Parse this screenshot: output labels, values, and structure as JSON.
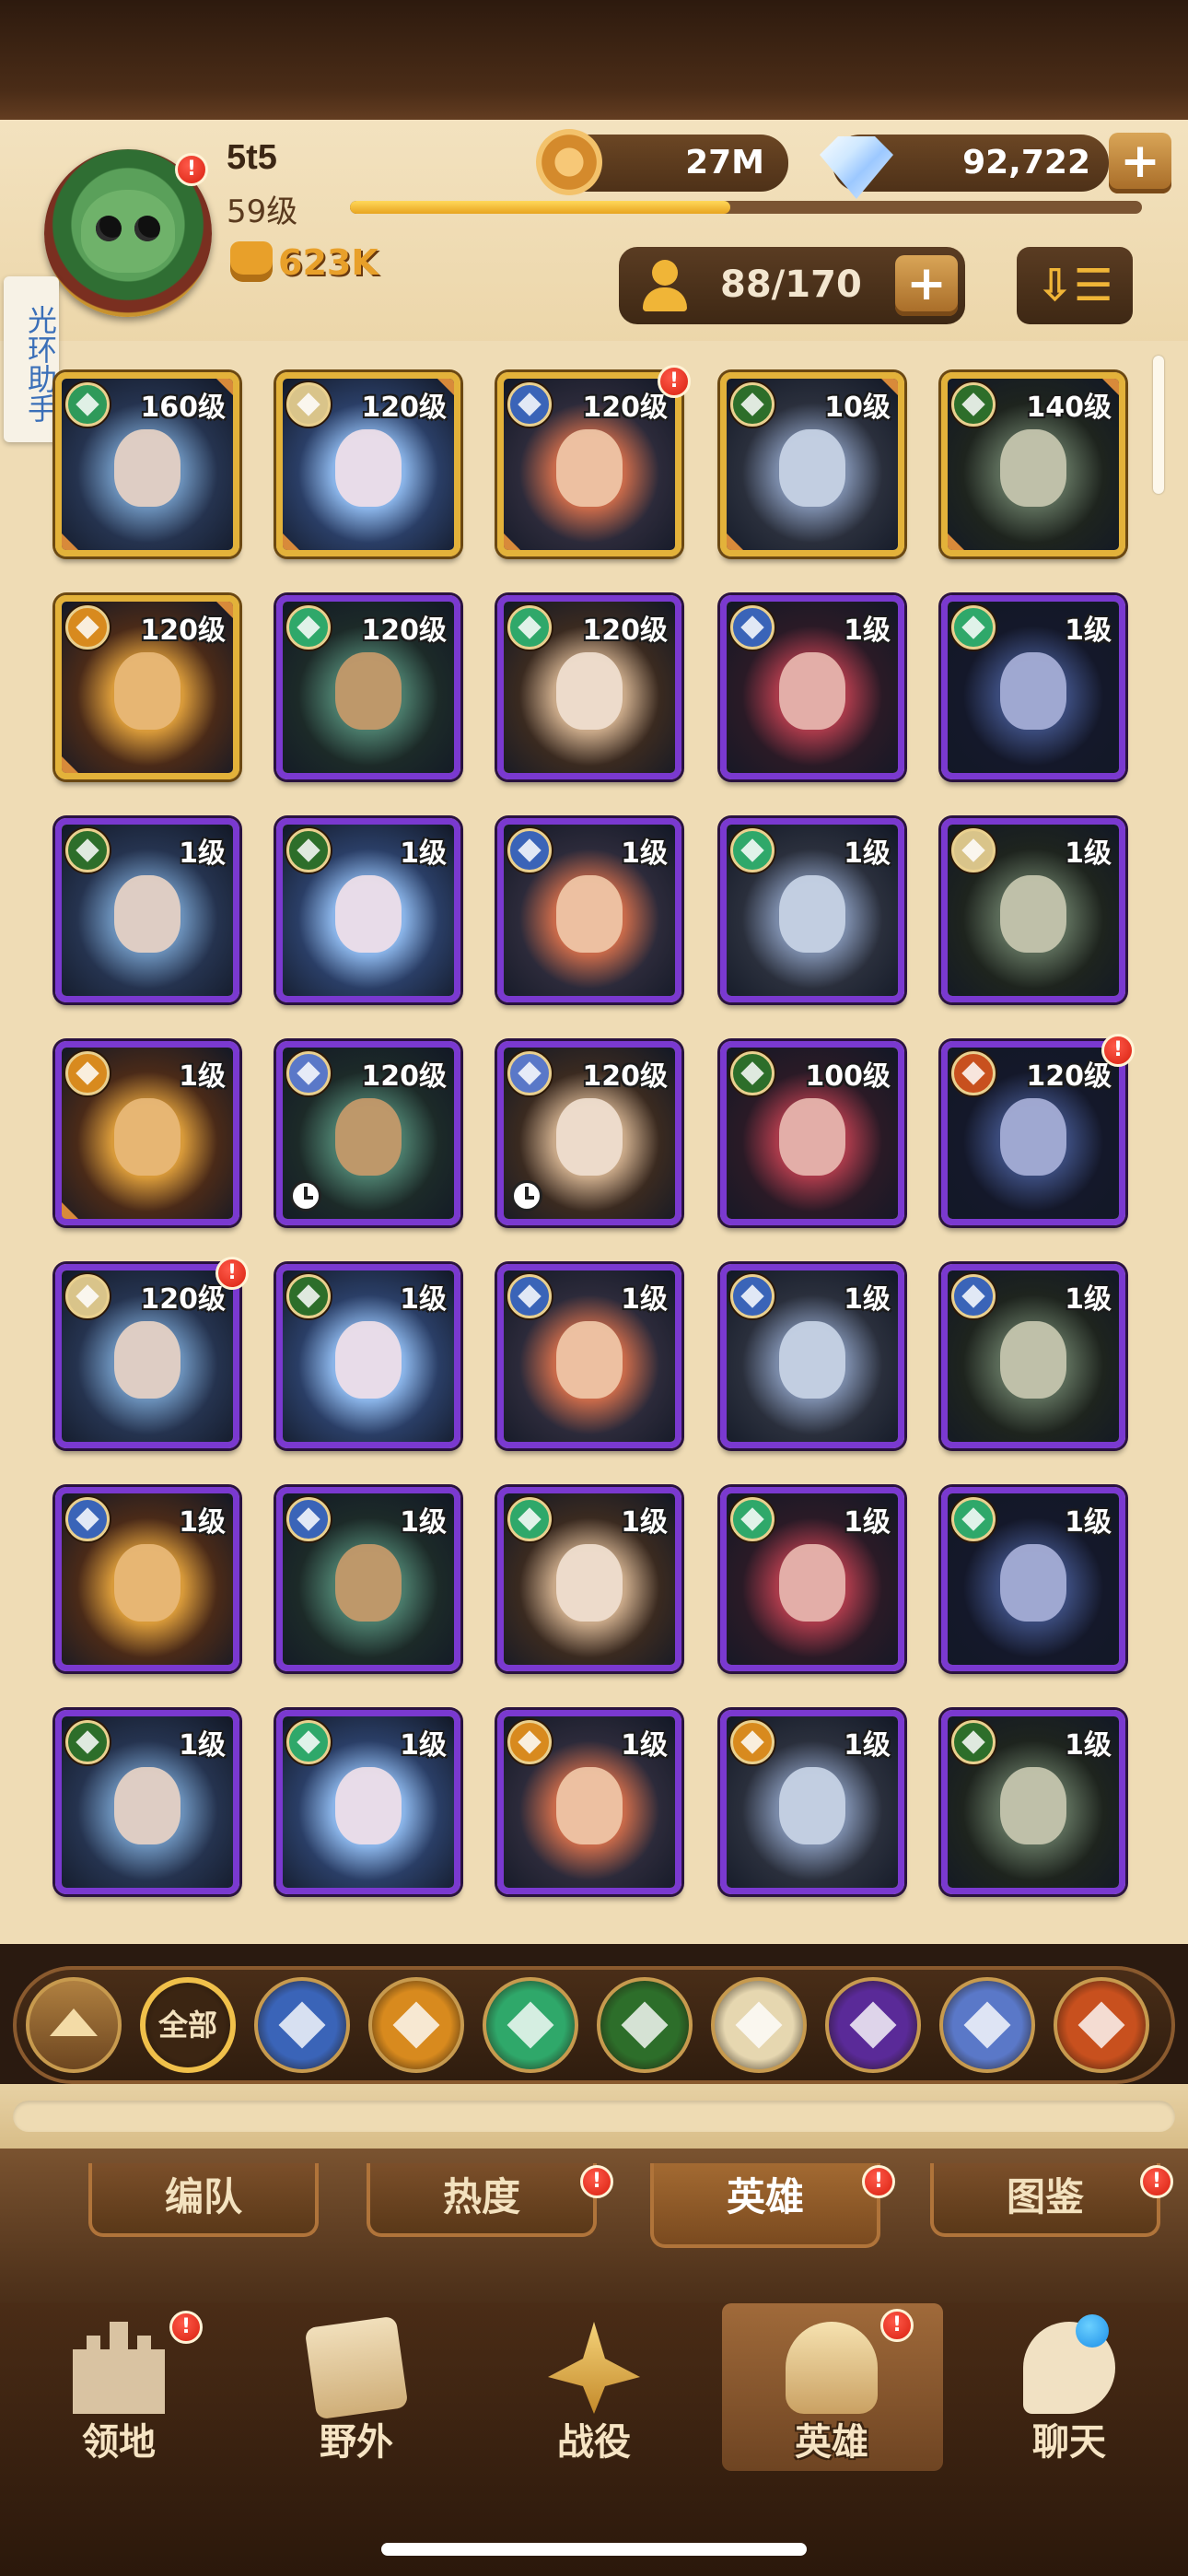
{
  "player": {
    "name": "5t5",
    "level": "59级",
    "xp_progress": 0.48,
    "power": "623K"
  },
  "currency": {
    "gold": "27M",
    "diamonds": "92,722",
    "plus": "+"
  },
  "roster": {
    "count": "88/170",
    "plus": "+",
    "sort_icon": "sort-icon"
  },
  "side_helper": "光环助手",
  "hero_rows": [
    [
      {
        "level": "160级",
        "frame": "gold",
        "faction": "forest",
        "alert": false
      },
      {
        "level": "120级",
        "frame": "gold",
        "faction": "celestial",
        "alert": false
      },
      {
        "level": "120级",
        "frame": "gold",
        "faction": "lightbearer",
        "alert": true
      },
      {
        "level": "10级",
        "frame": "gold",
        "faction": "graveborn",
        "alert": false
      },
      {
        "level": "140级",
        "frame": "gold",
        "faction": "graveborn",
        "alert": false
      }
    ],
    [
      {
        "level": "120级",
        "frame": "gold",
        "faction": "mauler",
        "alert": false
      },
      {
        "level": "120级",
        "frame": "purple",
        "faction": "wilder",
        "alert": false
      },
      {
        "level": "120级",
        "frame": "purple",
        "faction": "wilder",
        "alert": false
      },
      {
        "level": "1级",
        "frame": "purple",
        "faction": "lightbearer",
        "alert": false
      },
      {
        "level": "1级",
        "frame": "purple",
        "faction": "wilder",
        "alert": false
      }
    ],
    [
      {
        "level": "1级",
        "frame": "purple",
        "faction": "graveborn",
        "alert": false
      },
      {
        "level": "1级",
        "frame": "purple",
        "faction": "graveborn",
        "alert": false
      },
      {
        "level": "1级",
        "frame": "purple",
        "faction": "lightbearer",
        "alert": false
      },
      {
        "level": "1级",
        "frame": "purple",
        "faction": "wilder",
        "alert": false
      },
      {
        "level": "1级",
        "frame": "purple",
        "faction": "celestial",
        "alert": false
      }
    ],
    [
      {
        "level": "1级",
        "frame": "purple",
        "faction": "mauler",
        "alert": false
      },
      {
        "level": "120级",
        "frame": "purple",
        "faction": "dimensional",
        "alert": false,
        "clock": true
      },
      {
        "level": "120级",
        "frame": "purple",
        "faction": "dimensional",
        "alert": false,
        "clock": true
      },
      {
        "level": "100级",
        "frame": "purple",
        "faction": "graveborn",
        "alert": false
      },
      {
        "level": "120级",
        "frame": "purple",
        "faction": "dragon",
        "alert": true
      }
    ],
    [
      {
        "level": "120级",
        "frame": "purple",
        "faction": "celestial",
        "alert": true
      },
      {
        "level": "1级",
        "frame": "purple",
        "faction": "graveborn",
        "alert": false
      },
      {
        "level": "1级",
        "frame": "purple",
        "faction": "lightbearer",
        "alert": false
      },
      {
        "level": "1级",
        "frame": "purple",
        "faction": "lightbearer",
        "alert": false
      },
      {
        "level": "1级",
        "frame": "purple",
        "faction": "lightbearer",
        "alert": false
      }
    ],
    [
      {
        "level": "1级",
        "frame": "purple",
        "faction": "lightbearer",
        "alert": false
      },
      {
        "level": "1级",
        "frame": "purple",
        "faction": "lightbearer",
        "alert": false
      },
      {
        "level": "1级",
        "frame": "purple",
        "faction": "wilder",
        "alert": false
      },
      {
        "level": "1级",
        "frame": "purple",
        "faction": "wilder",
        "alert": false
      },
      {
        "level": "1级",
        "frame": "purple",
        "faction": "wilder",
        "alert": false
      }
    ],
    [
      {
        "level": "1级",
        "frame": "purple",
        "faction": "graveborn",
        "alert": false
      },
      {
        "level": "1级",
        "frame": "purple",
        "faction": "wilder",
        "alert": false
      },
      {
        "level": "1级",
        "frame": "purple",
        "faction": "mauler",
        "alert": false
      },
      {
        "level": "1级",
        "frame": "purple",
        "faction": "mauler",
        "alert": false
      },
      {
        "level": "1级",
        "frame": "purple",
        "faction": "graveborn",
        "alert": false
      }
    ]
  ],
  "faction_colors": {
    "forest": "#2f9a5a",
    "celestial": "#d9c48a",
    "lightbearer": "#3a64b8",
    "graveborn": "#2d6e2a",
    "mauler": "#d88a1e",
    "wilder": "#2fa86a",
    "dimensional": "#5a78c8",
    "hypogean": "#6a2fa8",
    "dragon": "#c8501e"
  },
  "filters": {
    "all_label": "全部",
    "items": [
      "collapse",
      "all",
      "lightbearer",
      "mauler",
      "wilder",
      "graveborn",
      "celestial",
      "hypogean",
      "dimensional",
      "dragon"
    ]
  },
  "subtabs": [
    {
      "label": "编队",
      "alert": false,
      "active": false
    },
    {
      "label": "热度",
      "alert": true,
      "active": false
    },
    {
      "label": "英雄",
      "alert": true,
      "active": true
    },
    {
      "label": "图鉴",
      "alert": true,
      "active": false
    }
  ],
  "nav": [
    {
      "label": "领地",
      "icon": "castle-icon",
      "alert": true,
      "active": false
    },
    {
      "label": "野外",
      "icon": "map-scroll-icon",
      "alert": false,
      "active": false
    },
    {
      "label": "战役",
      "icon": "crossed-swords-icon",
      "alert": false,
      "active": false
    },
    {
      "label": "英雄",
      "icon": "helmet-icon",
      "alert": true,
      "active": true
    },
    {
      "label": "聊天",
      "icon": "chat-bubble-icon",
      "alert": false,
      "active": false,
      "blue_dot": true
    }
  ],
  "alert_mark": "!"
}
